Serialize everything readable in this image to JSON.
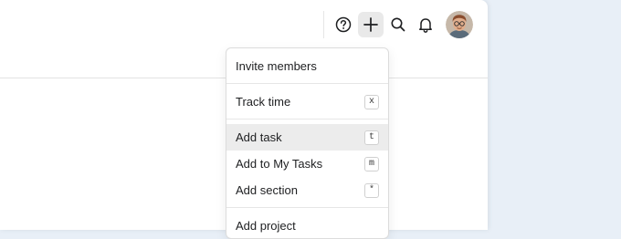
{
  "toolbar": {
    "help_icon": "question-circle-icon",
    "add_icon": "plus-icon",
    "search_icon": "search-icon",
    "notifications_icon": "bell-icon",
    "avatar_icon": "user-avatar"
  },
  "menu": {
    "items": [
      {
        "label": "Invite members",
        "shortcut": ""
      },
      {
        "label": "Track time",
        "shortcut": "x"
      },
      {
        "label": "Add task",
        "shortcut": "t"
      },
      {
        "label": "Add to My Tasks",
        "shortcut": "m"
      },
      {
        "label": "Add section",
        "shortcut": "*"
      },
      {
        "label": "Add project",
        "shortcut": ""
      }
    ]
  },
  "colors": {
    "background": "#e8eff7",
    "panel": "#ffffff",
    "selected_item": "#ececec",
    "text": "#1e1f21"
  }
}
